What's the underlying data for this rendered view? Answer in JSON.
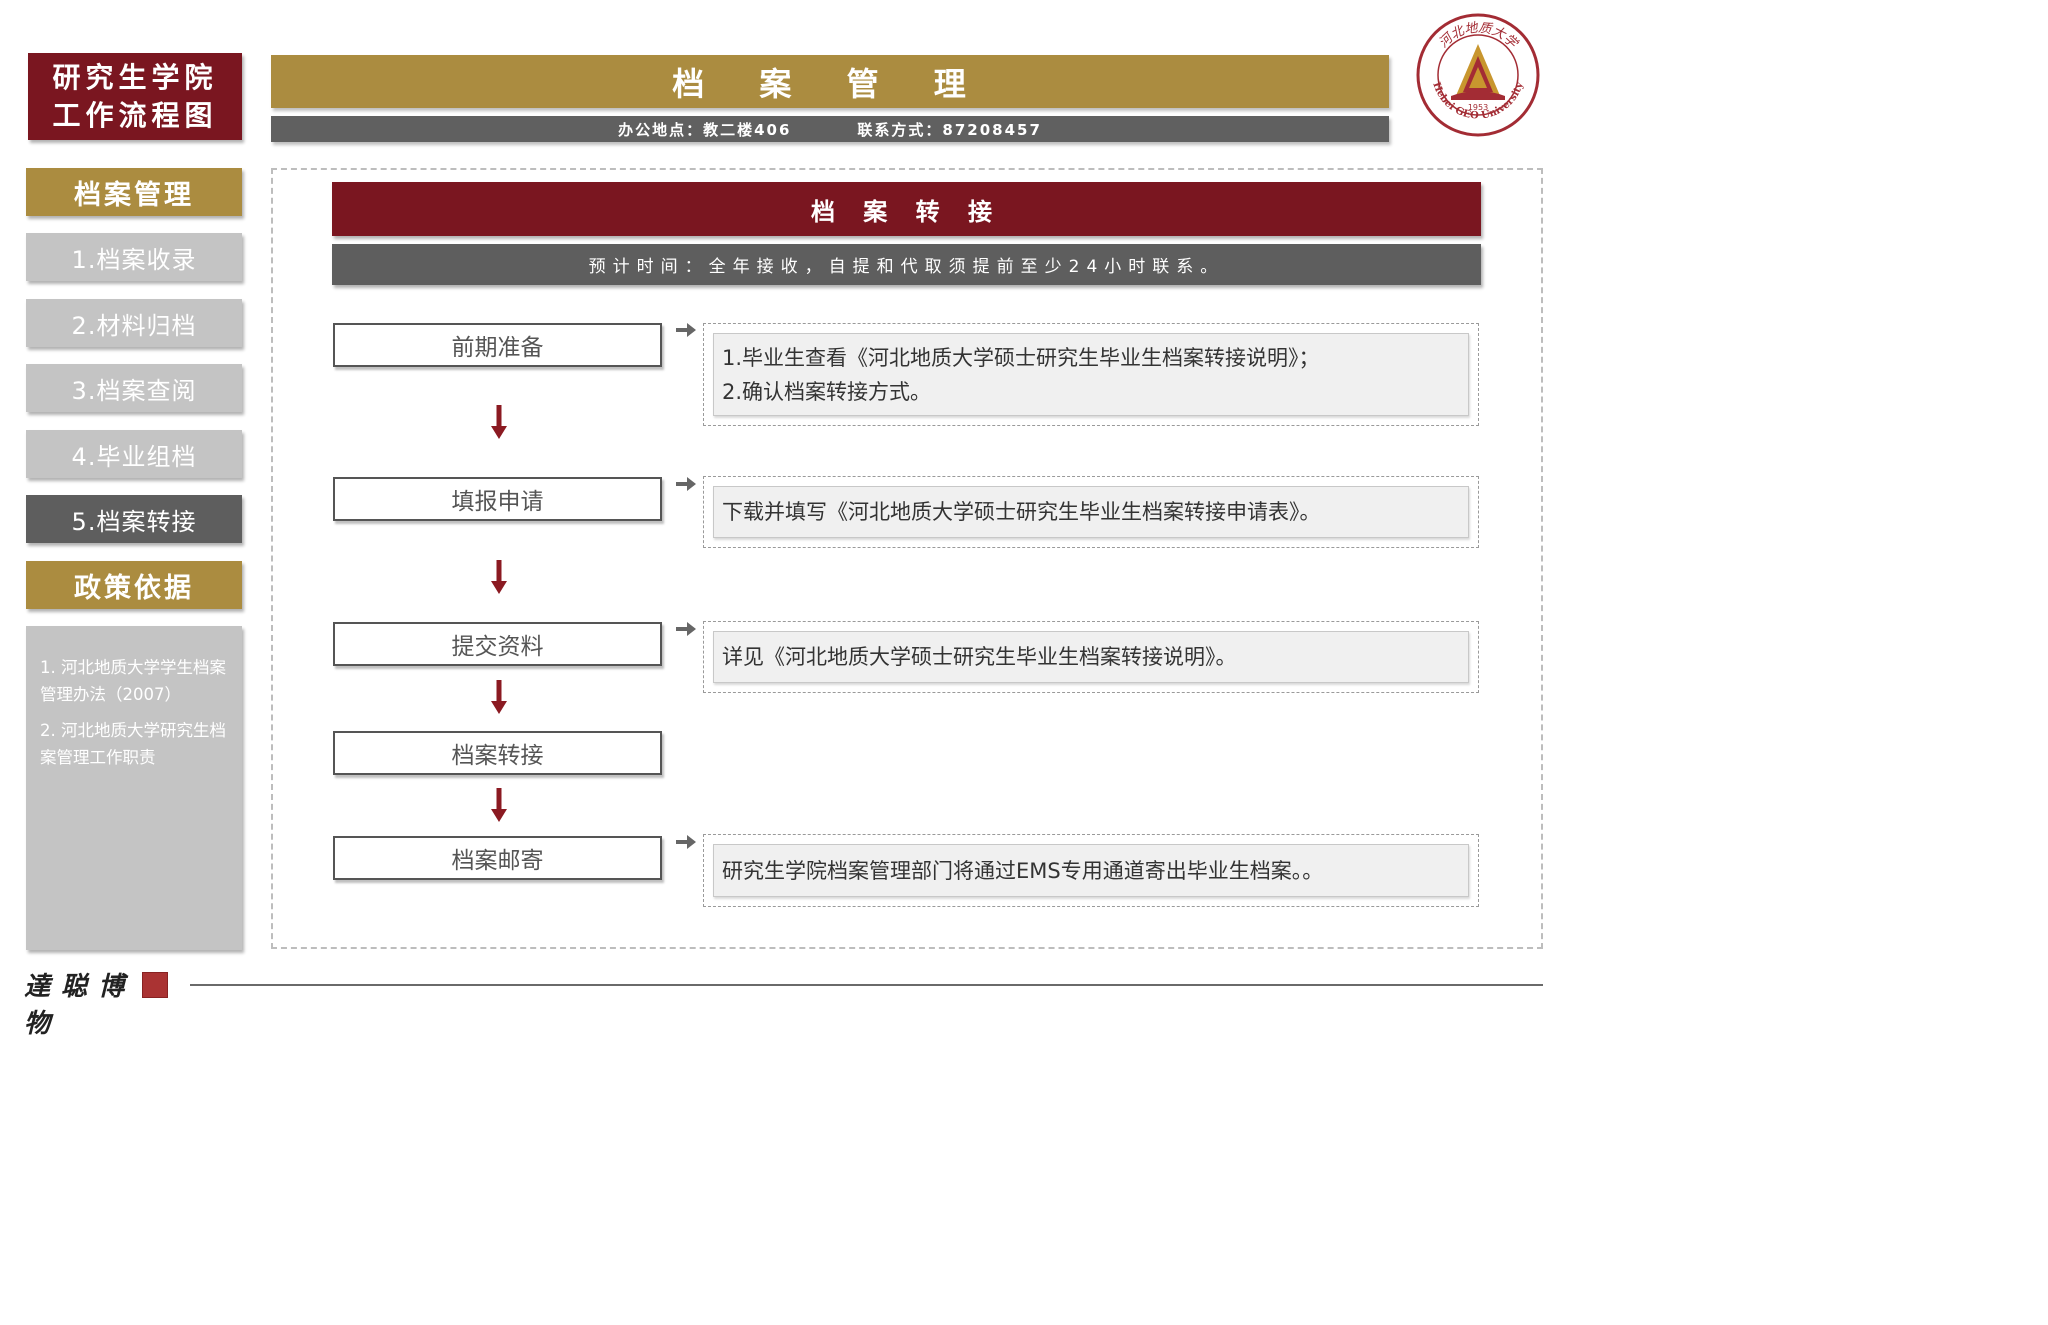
{
  "badge": {
    "line1": "研究生学院",
    "line2": "工作流程图"
  },
  "header": {
    "title": "档 案 管 理",
    "office": "办公地点：教二楼406",
    "contact": "联系方式：87208457"
  },
  "logo": {
    "icon": "university-seal-icon",
    "chinese_name": "河北地质大学",
    "english_name": "Hebei GEO University",
    "year": "1953",
    "colors": {
      "ring": "#a32c34",
      "mountain": "#c8962e",
      "mountain_band": "#a32c34"
    }
  },
  "sidebar": {
    "section1_title": "档案管理",
    "items": [
      {
        "label": "1.档案收录"
      },
      {
        "label": "2.材料归档"
      },
      {
        "label": "3.档案查阅"
      },
      {
        "label": "4.毕业组档"
      },
      {
        "label": "5.档案转接",
        "active": true
      }
    ],
    "section2_title": "政策依据",
    "policies": [
      "1. 河北地质大学学生档案管理办法（2007）",
      "2. 河北地质大学研究生档案管理工作职责"
    ]
  },
  "main": {
    "section_title": "档 案 转 接",
    "time_note": "预计时间：全年接收，自提和代取须提前至少24小时联系。",
    "steps": [
      {
        "label": "前期准备",
        "desc": [
          "1.毕业生查看《河北地质大学硕士研究生毕业生档案转接说明》；",
          "2.确认档案转接方式。"
        ]
      },
      {
        "label": "填报申请",
        "desc": [
          "下载并填写《河北地质大学硕士研究生毕业生档案转接申请表》。"
        ]
      },
      {
        "label": "提交资料",
        "desc": [
          "详见《河北地质大学硕士研究生毕业生档案转接说明》。"
        ]
      },
      {
        "label": "档案转接",
        "desc": []
      },
      {
        "label": "档案邮寄",
        "desc": [
          "研究生学院档案管理部门将通过EMS专用通道寄出毕业生档案。。"
        ]
      }
    ]
  },
  "footer": {
    "signature": "達 聪 博 物"
  },
  "colors": {
    "maroon": "#7a1620",
    "gold": "#ab8c40",
    "dark_gray": "#5e5e5e",
    "light_gray": "#c4c4c4",
    "arrow": "#8b1a22"
  }
}
